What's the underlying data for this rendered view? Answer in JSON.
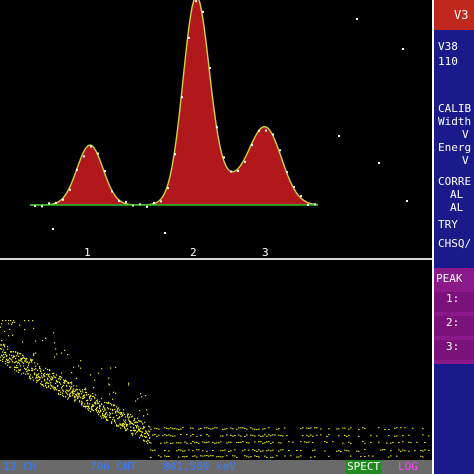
{
  "window": {
    "version_label": "V38"
  },
  "peak_plot": {
    "peak_labels": [
      "1",
      "2",
      "3"
    ],
    "colors": {
      "fill": "#b0181c",
      "outline": "#d0d040",
      "baseline": "#2ec02e"
    }
  },
  "spectrum_plot": {
    "color": "#f0f020"
  },
  "status_bar": {
    "channel": "13 CH",
    "counts": "706 CNT",
    "energy": "801.589 keV",
    "mode_spect": "SPECT",
    "mode_log": "LOG"
  },
  "side_panel": {
    "header": "V3",
    "lines": [
      "V38",
      "110",
      "CALIB",
      "Width",
      "V",
      "Energ",
      "V",
      "CORRE",
      "AL",
      "AL",
      "TRY",
      "CHSQ/"
    ],
    "peak_table": {
      "header": "PEAK",
      "rows": [
        "1:",
        "2:",
        "3:"
      ]
    }
  }
}
